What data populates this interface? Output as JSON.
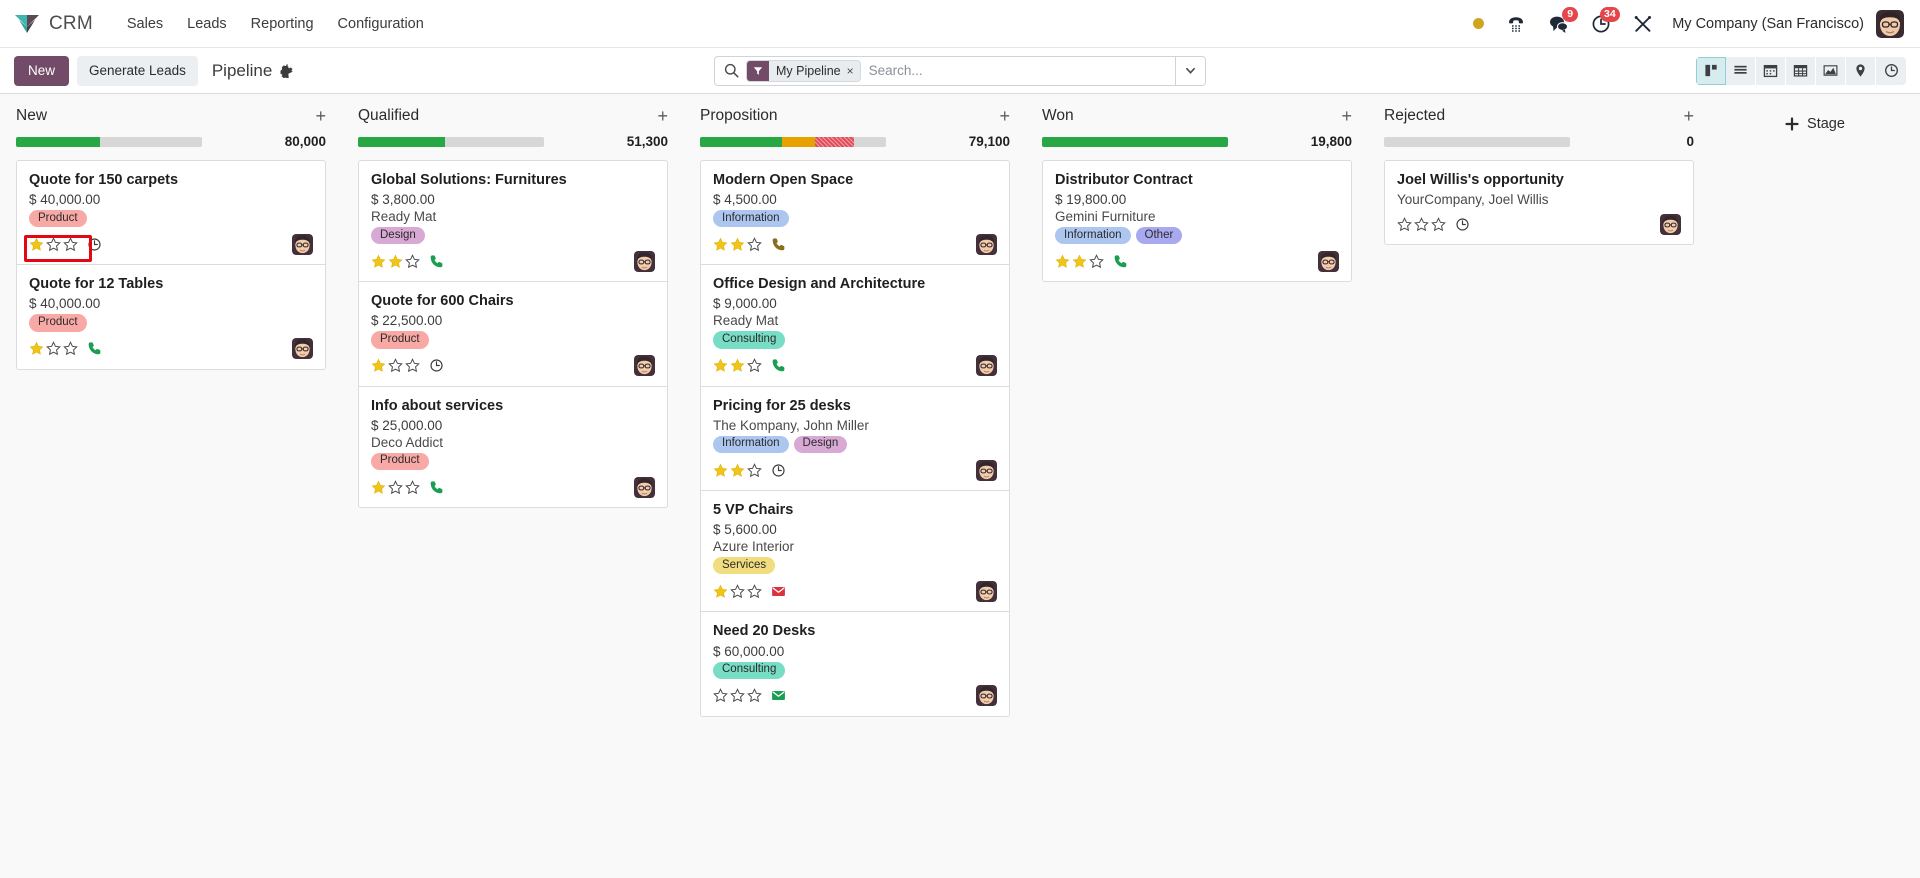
{
  "navbar": {
    "brand": "CRM",
    "menu": [
      {
        "label": "Sales"
      },
      {
        "label": "Leads"
      },
      {
        "label": "Reporting"
      },
      {
        "label": "Configuration"
      }
    ],
    "systray": {
      "status_dot": "presence-dot",
      "phone_icon": "voip-phone-icon",
      "messages_icon": "messages-icon",
      "messages_count": "9",
      "activities_icon": "activities-clock-icon",
      "activities_count": "34",
      "tools_icon": "debug-tools-icon"
    },
    "company": "My Company (San Francisco)",
    "avatar": "user-avatar"
  },
  "controlpanel": {
    "new_label": "New",
    "generate_leads_label": "Generate Leads",
    "breadcrumb": "Pipeline",
    "gear_icon": "gear-icon",
    "search": {
      "icon": "search-icon",
      "facet_icon": "filter-funnel-icon",
      "facet_label": "My Pipeline",
      "facet_remove": "×",
      "placeholder": "Search...",
      "value": "",
      "dropdown_icon": "chevron-down-icon"
    },
    "views": [
      {
        "name": "kanban",
        "icon": "kanban-icon",
        "active": true
      },
      {
        "name": "list",
        "icon": "list-icon",
        "active": false
      },
      {
        "name": "calendar",
        "icon": "calendar-icon",
        "active": false
      },
      {
        "name": "pivot",
        "icon": "pivot-table-icon",
        "active": false
      },
      {
        "name": "graph",
        "icon": "graph-icon",
        "active": false
      },
      {
        "name": "map",
        "icon": "map-pin-icon",
        "active": false
      },
      {
        "name": "activity",
        "icon": "activity-clock-icon",
        "active": false
      }
    ]
  },
  "add_stage": {
    "label": "Stage",
    "icon": "plus-icon"
  },
  "colors": {
    "brand_purple": "#714b67",
    "green": "#28a745",
    "orange": "#e8a200",
    "red": "#e14d5a",
    "grey": "#d7d7d7",
    "highlight": "#e30613"
  },
  "columns": [
    {
      "title": "New",
      "amount": "80,000",
      "progress": [
        {
          "color": "green",
          "pct": 45
        },
        {
          "color": "grey",
          "pct": 55
        }
      ],
      "cards": [
        {
          "title": "Quote for 150 carpets",
          "amount": "$ 40,000.00",
          "partner": "",
          "tags": [
            {
              "label": "Product",
              "cls": "product"
            }
          ],
          "stars": 1,
          "activity": "clock-icon",
          "activity_color": "#3c3c3c",
          "avatar": "user-avatar",
          "highlighted": true
        },
        {
          "title": "Quote for 12 Tables",
          "amount": "$ 40,000.00",
          "partner": "",
          "tags": [
            {
              "label": "Product",
              "cls": "product"
            }
          ],
          "stars": 1,
          "activity": "phone-icon",
          "activity_color": "#1a9e51",
          "avatar": "user-avatar",
          "highlighted": false
        }
      ]
    },
    {
      "title": "Qualified",
      "amount": "51,300",
      "progress": [
        {
          "color": "green",
          "pct": 47
        },
        {
          "color": "grey",
          "pct": 53
        }
      ],
      "cards": [
        {
          "title": "Global Solutions: Furnitures",
          "amount": "$ 3,800.00",
          "partner": "Ready Mat",
          "tags": [
            {
              "label": "Design",
              "cls": "design"
            }
          ],
          "stars": 2,
          "activity": "phone-icon",
          "activity_color": "#1a9e51",
          "avatar": "user-avatar",
          "highlighted": false
        },
        {
          "title": "Quote for 600 Chairs",
          "amount": "$ 22,500.00",
          "partner": "",
          "tags": [
            {
              "label": "Product",
              "cls": "product"
            }
          ],
          "stars": 1,
          "activity": "clock-icon",
          "activity_color": "#3c3c3c",
          "avatar": "user-avatar",
          "highlighted": false
        },
        {
          "title": "Info about services",
          "amount": "$ 25,000.00",
          "partner": "Deco Addict",
          "tags": [
            {
              "label": "Product",
              "cls": "product"
            }
          ],
          "stars": 1,
          "activity": "phone-icon",
          "activity_color": "#1a9e51",
          "avatar": "user-avatar",
          "highlighted": false
        }
      ]
    },
    {
      "title": "Proposition",
      "amount": "79,100",
      "progress": [
        {
          "color": "green",
          "pct": 44
        },
        {
          "color": "orange",
          "pct": 18
        },
        {
          "color": "red",
          "pct": 21
        },
        {
          "color": "grey",
          "pct": 17
        }
      ],
      "cards": [
        {
          "title": "Modern Open Space",
          "amount": "$ 4,500.00",
          "partner": "",
          "tags": [
            {
              "label": "Information",
              "cls": "information"
            }
          ],
          "stars": 2,
          "activity": "phone-icon",
          "activity_color": "#8a6d1f",
          "avatar": "user-avatar",
          "highlighted": false
        },
        {
          "title": "Office Design and Architecture",
          "amount": "$ 9,000.00",
          "partner": "Ready Mat",
          "tags": [
            {
              "label": "Consulting",
              "cls": "consulting"
            }
          ],
          "stars": 2,
          "activity": "phone-icon",
          "activity_color": "#1a9e51",
          "avatar": "user-avatar",
          "highlighted": false
        },
        {
          "title": "Pricing for 25 desks",
          "amount": "",
          "partner": "The Kompany, John Miller",
          "tags": [
            {
              "label": "Information",
              "cls": "information"
            },
            {
              "label": "Design",
              "cls": "design"
            }
          ],
          "stars": 2,
          "activity": "clock-icon",
          "activity_color": "#3c3c3c",
          "avatar": "user-avatar",
          "highlighted": false
        },
        {
          "title": "5 VP Chairs",
          "amount": "$ 5,600.00",
          "partner": "Azure Interior",
          "tags": [
            {
              "label": "Services",
              "cls": "services"
            }
          ],
          "stars": 1,
          "activity": "envelope-icon",
          "activity_color": "#d9333f",
          "avatar": "user-avatar",
          "highlighted": false
        },
        {
          "title": "Need 20 Desks",
          "amount": "$ 60,000.00",
          "partner": "",
          "tags": [
            {
              "label": "Consulting",
              "cls": "consulting"
            }
          ],
          "stars": 0,
          "activity": "envelope-icon",
          "activity_color": "#1a9e51",
          "avatar": "user-avatar",
          "highlighted": false
        }
      ]
    },
    {
      "title": "Won",
      "amount": "19,800",
      "progress": [
        {
          "color": "green",
          "pct": 100
        }
      ],
      "cards": [
        {
          "title": "Distributor Contract",
          "amount": "$ 19,800.00",
          "partner": "Gemini Furniture",
          "tags": [
            {
              "label": "Information",
              "cls": "information"
            },
            {
              "label": "Other",
              "cls": "other"
            }
          ],
          "stars": 2,
          "activity": "phone-icon",
          "activity_color": "#1a9e51",
          "avatar": "user-avatar",
          "highlighted": false
        }
      ]
    },
    {
      "title": "Rejected",
      "amount": "0",
      "progress": [
        {
          "color": "grey",
          "pct": 100
        }
      ],
      "cards": [
        {
          "title": "Joel Willis's opportunity",
          "amount": "",
          "partner": "YourCompany, Joel Willis",
          "tags": [],
          "stars": 0,
          "activity": "clock-icon",
          "activity_color": "#3c3c3c",
          "avatar": "user-avatar",
          "highlighted": false
        }
      ]
    }
  ]
}
